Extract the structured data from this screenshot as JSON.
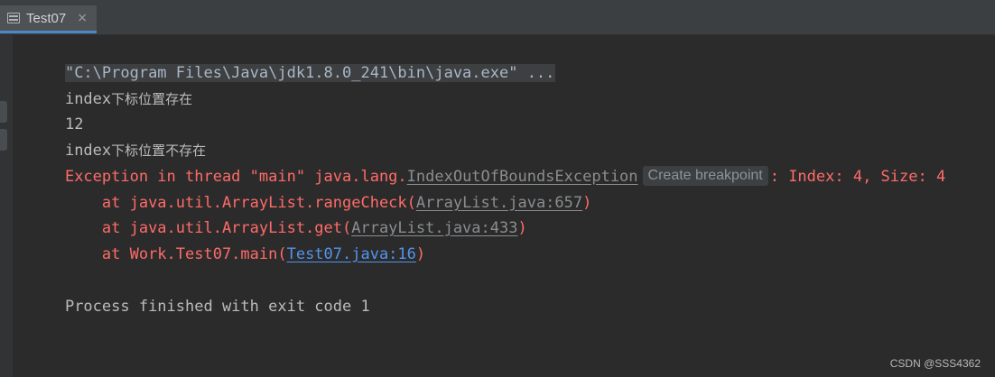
{
  "tab": {
    "title": "Test07",
    "close_glyph": "×"
  },
  "console": {
    "command": "\"C:\\Program Files\\Java\\jdk1.8.0_241\\bin\\java.exe\" ...",
    "line1_prefix": "index",
    "line1_cjk": "下标位置存在",
    "line2": "12",
    "line3_prefix": "index",
    "line3_cjk": "下标位置不存在",
    "exception_prefix": "Exception in thread \"main\" java.lang.",
    "exception_class": "IndexOutOfBoundsException",
    "breakpoint_label": "Create breakpoint",
    "exception_suffix": ": Index: 4, Size: 4",
    "stack": [
      {
        "prefix": "    at java.util.ArrayList.rangeCheck(",
        "link": "ArrayList.java:657",
        "suffix": ")"
      },
      {
        "prefix": "    at java.util.ArrayList.get(",
        "link": "ArrayList.java:433",
        "suffix": ")"
      },
      {
        "prefix": "    at Work.Test07.main(",
        "link": "Test07.java:16",
        "suffix": ")"
      }
    ],
    "finish": "Process finished with exit code 1"
  },
  "watermark": "CSDN @SSS4362",
  "colors": {
    "background": "#2b2b2b",
    "error": "#ff6b68",
    "link": "#5394ec",
    "text": "#bbbbbb"
  },
  "icons": {
    "tab": "run-console-icon",
    "close": "close-icon"
  }
}
